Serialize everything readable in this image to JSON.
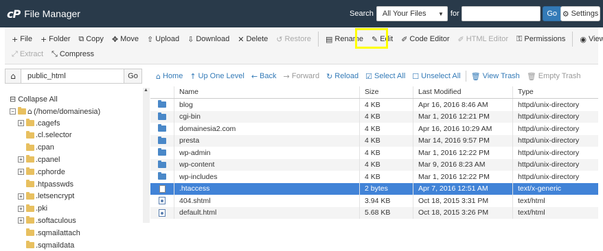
{
  "header": {
    "logo_mark": "cP",
    "title": "File Manager",
    "search_label": "Search",
    "search_scope": "All Your Files",
    "for_label": "for",
    "search_value": "",
    "go_label": "Go",
    "settings_label": "Settings"
  },
  "toolbar": {
    "row1": [
      {
        "icon": "plus-icon",
        "glyph": "+",
        "label": "File",
        "disabled": false
      },
      {
        "icon": "plus-icon",
        "glyph": "+",
        "label": "Folder",
        "disabled": false
      },
      {
        "icon": "copy-icon",
        "glyph": "⧉",
        "label": "Copy",
        "disabled": false
      },
      {
        "icon": "move-icon",
        "glyph": "✥",
        "label": "Move",
        "disabled": false
      },
      {
        "icon": "upload-icon",
        "glyph": "⇧",
        "label": "Upload",
        "disabled": false
      },
      {
        "icon": "download-icon",
        "glyph": "⇩",
        "label": "Download",
        "disabled": false
      },
      {
        "icon": "delete-icon",
        "glyph": "✕",
        "label": "Delete",
        "disabled": false
      },
      {
        "icon": "restore-icon",
        "glyph": "↺",
        "label": "Restore",
        "disabled": true
      },
      {
        "icon": "rename-icon",
        "glyph": "▤",
        "label": "Rename",
        "disabled": false
      },
      {
        "icon": "pencil-icon",
        "glyph": "✎",
        "label": "Edit",
        "disabled": false
      },
      {
        "icon": "code-editor-icon",
        "glyph": "✐",
        "label": "Code Editor",
        "disabled": false
      },
      {
        "icon": "html-editor-icon",
        "glyph": "✐",
        "label": "HTML Editor",
        "disabled": true
      },
      {
        "icon": "key-icon",
        "glyph": "⚿",
        "label": "Permissions",
        "disabled": false
      },
      {
        "icon": "eye-icon",
        "glyph": "◉",
        "label": "View",
        "disabled": false
      }
    ],
    "row2": [
      {
        "icon": "extract-icon",
        "glyph": "⤢",
        "label": "Extract",
        "disabled": true
      },
      {
        "icon": "compress-icon",
        "glyph": "⤡",
        "label": "Compress",
        "disabled": false
      }
    ]
  },
  "path": {
    "value": "public_html",
    "go_label": "Go"
  },
  "nav": [
    {
      "icon": "home-icon",
      "glyph": "⌂",
      "label": "Home",
      "disabled": false
    },
    {
      "icon": "up-arrow-icon",
      "glyph": "↑",
      "label": "Up One Level",
      "disabled": false
    },
    {
      "icon": "back-arrow-icon",
      "glyph": "←",
      "label": "Back",
      "disabled": false
    },
    {
      "icon": "forward-arrow-icon",
      "glyph": "→",
      "label": "Forward",
      "disabled": true
    },
    {
      "icon": "reload-icon",
      "glyph": "↻",
      "label": "Reload",
      "disabled": false
    },
    {
      "icon": "check-icon",
      "glyph": "☑",
      "label": "Select All",
      "disabled": false
    },
    {
      "icon": "square-icon",
      "glyph": "☐",
      "label": "Unselect All",
      "disabled": false
    },
    {
      "icon": "trash-icon",
      "glyph": "🗑",
      "label": "View Trash",
      "disabled": false
    },
    {
      "icon": "trash-icon",
      "glyph": "🗑",
      "label": "Empty Trash",
      "disabled": true
    }
  ],
  "tree": {
    "collapse_label": "Collapse All",
    "root_label": "(/home/domainesia)",
    "items": [
      {
        "label": ".cagefs",
        "expandable": true
      },
      {
        "label": ".cl.selector",
        "expandable": false
      },
      {
        "label": ".cpan",
        "expandable": false
      },
      {
        "label": ".cpanel",
        "expandable": true
      },
      {
        "label": ".cphorde",
        "expandable": true
      },
      {
        "label": ".htpasswds",
        "expandable": false
      },
      {
        "label": ".letsencrypt",
        "expandable": true
      },
      {
        "label": ".pki",
        "expandable": true
      },
      {
        "label": ".softaculous",
        "expandable": true
      },
      {
        "label": ".sqmailattach",
        "expandable": false
      },
      {
        "label": ".sqmaildata",
        "expandable": false
      }
    ]
  },
  "table": {
    "columns": [
      "Name",
      "Size",
      "Last Modified",
      "Type"
    ],
    "rows": [
      {
        "icon": "folder-icon",
        "kind": "dir",
        "name": "blog",
        "size": "4 KB",
        "modified": "Apr 16, 2016 8:46 AM",
        "type": "httpd/unix-directory"
      },
      {
        "icon": "folder-icon",
        "kind": "dir",
        "name": "cgi-bin",
        "size": "4 KB",
        "modified": "Mar 1, 2016 12:21 PM",
        "type": "httpd/unix-directory"
      },
      {
        "icon": "folder-icon",
        "kind": "dir",
        "name": "domainesia2.com",
        "size": "4 KB",
        "modified": "Apr 16, 2016 10:29 AM",
        "type": "httpd/unix-directory"
      },
      {
        "icon": "folder-icon",
        "kind": "dir",
        "name": "presta",
        "size": "4 KB",
        "modified": "Mar 14, 2016 9:57 PM",
        "type": "httpd/unix-directory"
      },
      {
        "icon": "folder-icon",
        "kind": "dir",
        "name": "wp-admin",
        "size": "4 KB",
        "modified": "Mar 1, 2016 12:22 PM",
        "type": "httpd/unix-directory"
      },
      {
        "icon": "folder-icon",
        "kind": "dir",
        "name": "wp-content",
        "size": "4 KB",
        "modified": "Mar 9, 2016 8:23 AM",
        "type": "httpd/unix-directory"
      },
      {
        "icon": "folder-icon",
        "kind": "dir",
        "name": "wp-includes",
        "size": "4 KB",
        "modified": "Mar 1, 2016 12:22 PM",
        "type": "httpd/unix-directory"
      },
      {
        "icon": "file-icon",
        "kind": "file",
        "name": ".htaccess",
        "size": "2 bytes",
        "modified": "Apr 7, 2016 12:51 AM",
        "type": "text/x-generic",
        "selected": true
      },
      {
        "icon": "html-file-icon",
        "kind": "html",
        "name": "404.shtml",
        "size": "3.94 KB",
        "modified": "Oct 18, 2015 3:31 PM",
        "type": "text/html"
      },
      {
        "icon": "html-file-icon",
        "kind": "html",
        "name": "default.html",
        "size": "5.68 KB",
        "modified": "Oct 18, 2015 3:26 PM",
        "type": "text/html"
      }
    ]
  },
  "colors": {
    "header_bg": "#293a4a",
    "primary": "#337ab7",
    "selected_row": "#4183d7",
    "highlight": "#ffff00"
  }
}
